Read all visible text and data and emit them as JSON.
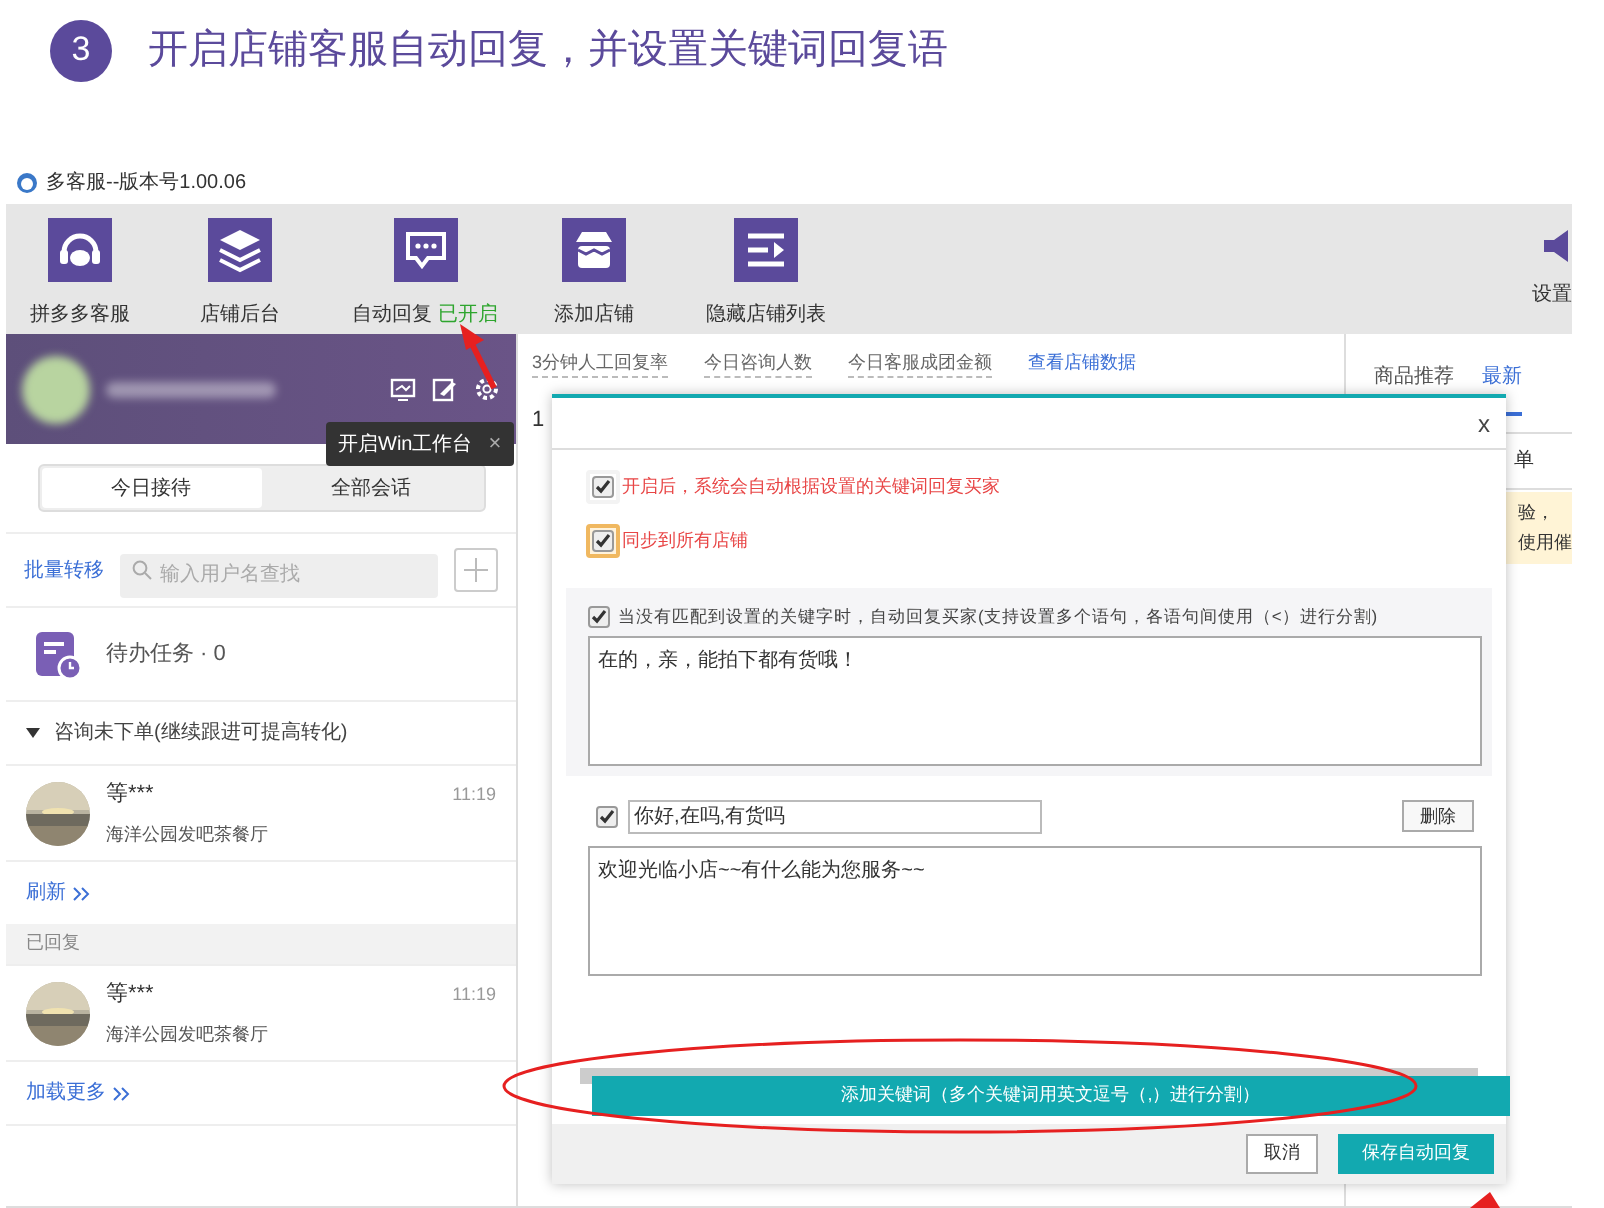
{
  "tutorial": {
    "step": "3",
    "title": "开启店铺客服自动回复，并设置关键词回复语"
  },
  "app": {
    "title": "多客服--版本号1.00.06"
  },
  "toolbar": [
    {
      "label": "拼多多客服"
    },
    {
      "label": "店铺后台"
    },
    {
      "label": "自动回复",
      "status": "已开启"
    },
    {
      "label": "添加店铺"
    },
    {
      "label": "隐藏店铺列表"
    }
  ],
  "toolbar_right": "设置",
  "account": {
    "tooltip": "开启Win工作台",
    "tooltip_close": "×"
  },
  "session_tabs": [
    {
      "label": "今日接待",
      "selected": true
    },
    {
      "label": "全部会话",
      "selected": false
    }
  ],
  "batch_transfer": "批量转移",
  "search": {
    "placeholder": "输入用户名查找"
  },
  "todo": "待办任务 · 0",
  "groups": [
    {
      "title": "咨询未下单(继续跟进可提高转化)",
      "kind": "toggle",
      "conversations": [
        {
          "name": "等***",
          "shop": "海洋公园发吧茶餐厅",
          "time": "11:19"
        }
      ],
      "more": "刷新"
    },
    {
      "title": "已回复",
      "kind": "band",
      "conversations": [
        {
          "name": "等***",
          "shop": "海洋公园发吧茶餐厅",
          "time": "11:19"
        }
      ],
      "more": "加载更多"
    }
  ],
  "stats": {
    "columns": [
      "3分钟人工回复率",
      "今日咨询人数",
      "今日客服成团金额"
    ],
    "first_value": "1",
    "link": "查看店铺数据"
  },
  "right_panel": {
    "tabs": [
      {
        "label": "商品推荐",
        "selected": false
      },
      {
        "label": "最新",
        "selected": true
      }
    ],
    "row": "单",
    "notice": [
      "验，",
      "使用催"
    ]
  },
  "dialog": {
    "close": "x",
    "options": [
      {
        "label": "开启后，系统会自动根据设置的关键词回复买家",
        "checked": true,
        "focused": false
      },
      {
        "label": "同步到所有店铺",
        "checked": true,
        "focused": true
      }
    ],
    "fallback": {
      "checked": true,
      "label": "当没有匹配到设置的关键字时，自动回复买家(支持设置多个语句，各语句间使用（<）进行分割)",
      "reply": "在的，亲，能拍下都有货哦！"
    },
    "keywords": [
      {
        "checked": true,
        "keywords": "你好,在吗,有货吗",
        "delete": "删除",
        "reply": "欢迎光临小店~~有什么能为您服务~~"
      }
    ],
    "add_button": "添加关键词（多个关键词用英文逗号（,）进行分割）",
    "cancel": "取消",
    "save": "保存自动回复"
  }
}
